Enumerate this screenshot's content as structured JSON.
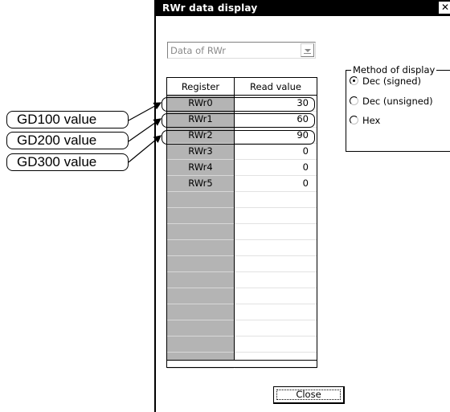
{
  "window": {
    "title": "RWr data display",
    "close_glyph": "✕"
  },
  "data_select": {
    "value": "Data of RWr"
  },
  "table": {
    "columns": [
      "Register",
      "Read value"
    ],
    "rows": [
      {
        "register": "RWr0",
        "value": "30"
      },
      {
        "register": "RWr1",
        "value": "60"
      },
      {
        "register": "RWr2",
        "value": "90"
      },
      {
        "register": "RWr3",
        "value": "0"
      },
      {
        "register": "RWr4",
        "value": "0"
      },
      {
        "register": "RWr5",
        "value": "0"
      }
    ],
    "empty_rows": 11
  },
  "display_method": {
    "legend": "Method of display",
    "options": [
      "Dec (signed)",
      "Dec (unsigned)",
      "Hex"
    ],
    "selected": "Dec (signed)"
  },
  "buttons": {
    "close": "Close"
  },
  "callouts": [
    "GD100 value",
    "GD200 value",
    "GD300 value"
  ],
  "colors": {
    "title_bar": "#000000",
    "register_column": "#b4b4b4",
    "disabled_text": "#8a8a8a"
  }
}
